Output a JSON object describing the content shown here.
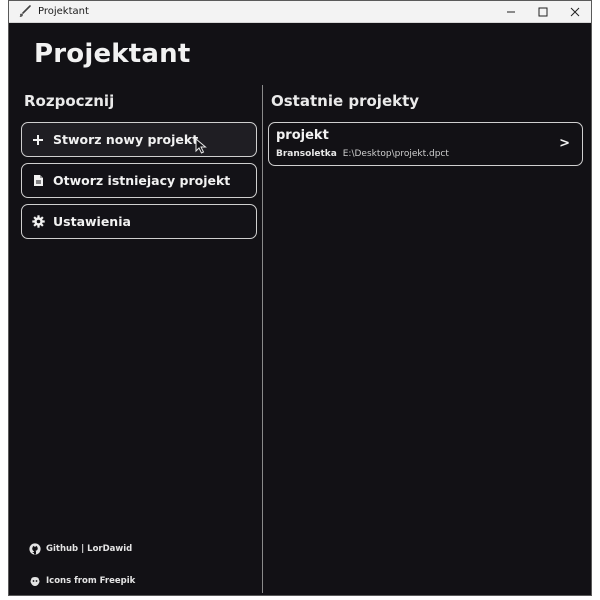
{
  "window": {
    "title": "Projektant"
  },
  "app": {
    "title": "Projektant"
  },
  "left": {
    "heading": "Rozpocznij",
    "buttons": [
      {
        "label": "Stworz nowy projekt",
        "icon": "plus-icon"
      },
      {
        "label": "Otworz istniejacy projekt",
        "icon": "document-icon"
      },
      {
        "label": "Ustawienia",
        "icon": "gear-icon"
      }
    ]
  },
  "right": {
    "heading": "Ostatnie projekty",
    "projects": [
      {
        "name": "projekt",
        "user": "Bransoletka",
        "path": "E:\\Desktop\\projekt.dpct",
        "chevron": ">"
      }
    ]
  },
  "footer": {
    "github": "Github | LorDawid",
    "credits": "Icons from Freepik"
  },
  "colors": {
    "background": "#121115",
    "text": "#f2f2f2",
    "border": "#cfcfcf",
    "titlebar": "#f3f3f3"
  }
}
